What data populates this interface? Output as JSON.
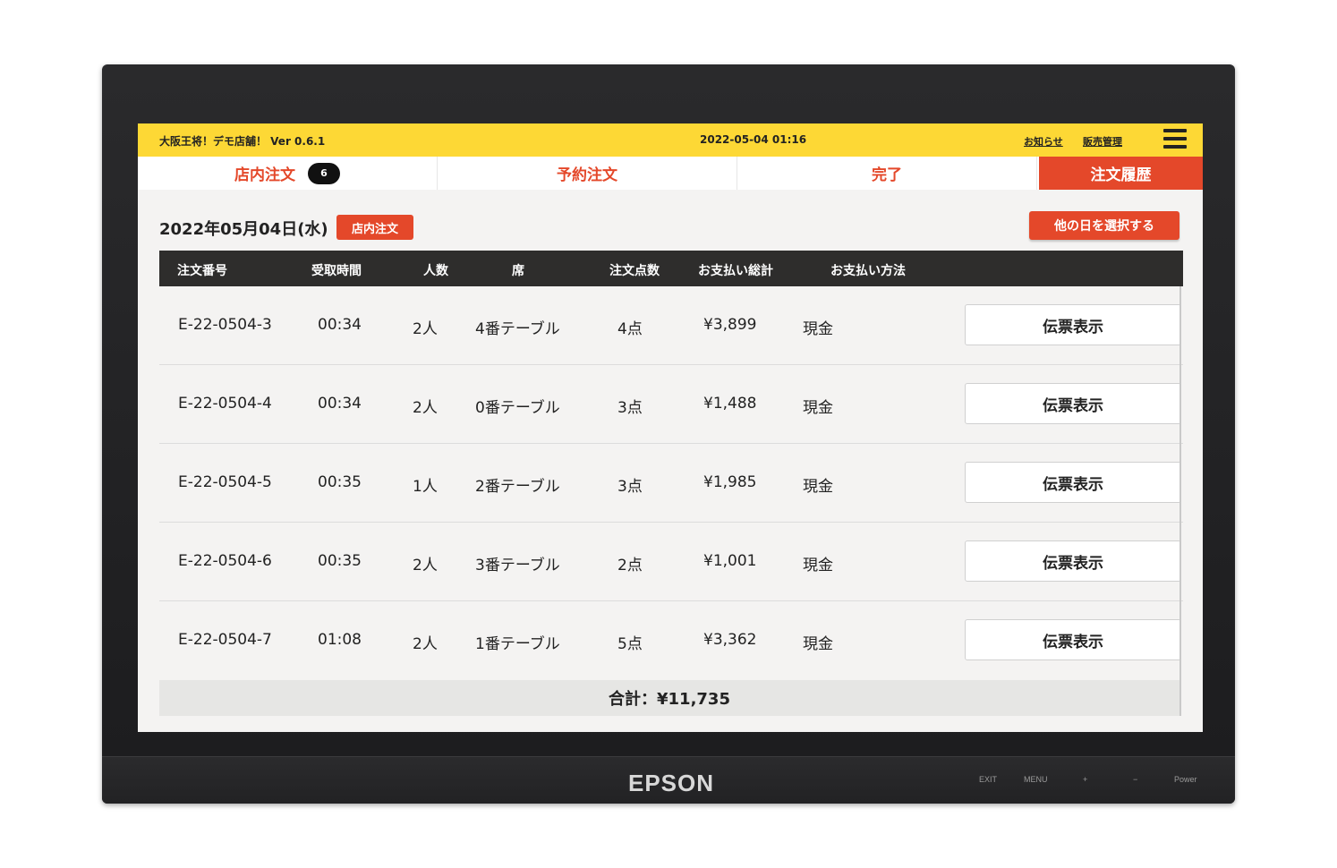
{
  "device": {
    "brand": "EPSON",
    "buttons": [
      "EXIT",
      "MENU",
      "+",
      "−",
      "Power"
    ]
  },
  "header": {
    "app_title": "大阪王将！デモ店舗！ Ver 0.6.1",
    "datetime": "2022-05-04 01:16",
    "links": [
      "お知らせ",
      "販売管理"
    ],
    "menu_icon": "hamburger-icon",
    "bg_color": "#fdd835"
  },
  "tabs": [
    {
      "label": "店内注文",
      "badge": "6"
    },
    {
      "label": "予約注文"
    },
    {
      "label": "完了"
    },
    {
      "label": "注文履歴",
      "active": true
    }
  ],
  "main": {
    "date": "2022年05月04日(水)",
    "date_badge": "店内注文",
    "other_day_button": "他の日を選択する",
    "accent_color": "#e4482a"
  },
  "table": {
    "headers": [
      "注文番号",
      "受取時間",
      "人数",
      "席",
      "注文点数",
      "お支払い総計",
      "お支払い方法"
    ],
    "rows": [
      {
        "order_no": "E-22-0504-3",
        "time": "00:34",
        "people": "2人",
        "seat": "4番テーブル",
        "items": "4点",
        "total": "¥3,899",
        "method": "現金",
        "action": "伝票表示"
      },
      {
        "order_no": "E-22-0504-4",
        "time": "00:34",
        "people": "2人",
        "seat": "0番テーブル",
        "items": "3点",
        "total": "¥1,488",
        "method": "現金",
        "action": "伝票表示"
      },
      {
        "order_no": "E-22-0504-5",
        "time": "00:35",
        "people": "1人",
        "seat": "2番テーブル",
        "items": "3点",
        "total": "¥1,985",
        "method": "現金",
        "action": "伝票表示"
      },
      {
        "order_no": "E-22-0504-6",
        "time": "00:35",
        "people": "2人",
        "seat": "3番テーブル",
        "items": "2点",
        "total": "¥1,001",
        "method": "現金",
        "action": "伝票表示"
      },
      {
        "order_no": "E-22-0504-7",
        "time": "01:08",
        "people": "2人",
        "seat": "1番テーブル",
        "items": "5点",
        "total": "¥3,362",
        "method": "現金",
        "action": "伝票表示"
      }
    ],
    "total_label": "合計：¥11,735"
  }
}
